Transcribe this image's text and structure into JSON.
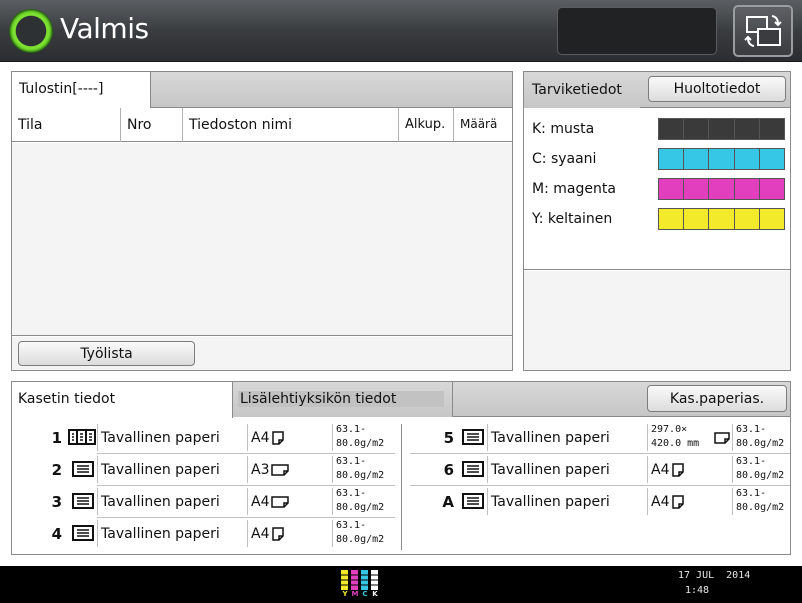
{
  "header": {
    "status": "Valmis"
  },
  "printer_panel": {
    "tab_label": "Tulostin[----]",
    "columns": [
      "Tila",
      "Nro",
      "Tiedoston nimi",
      "Alkup.",
      "Määrä"
    ],
    "job_list_button": "Työlista"
  },
  "supplies_panel": {
    "tab_label": "Tarviketiedot",
    "maintenance_button": "Huoltotiedot",
    "toners": [
      {
        "label": "K: musta",
        "color": "#3a3a3a",
        "level": 1.0
      },
      {
        "label": "C: syaani",
        "color": "#36c6e6",
        "level": 1.0
      },
      {
        "label": "M: magenta",
        "color": "#e23fbf",
        "level": 1.0
      },
      {
        "label": "Y: keltainen",
        "color": "#f2ea2a",
        "level": 1.0
      }
    ]
  },
  "tray_panel": {
    "tab_cassette": "Kasetin tiedot",
    "tab_feeder": "Lisälehtiyksikön tiedot",
    "paper_settings_button": "Kas.paperias.",
    "trays_left": [
      {
        "num": "1",
        "type": "Tavallinen paperi",
        "size": "A4",
        "w1": "63.1-",
        "w2": "80.0g/m2"
      },
      {
        "num": "2",
        "type": "Tavallinen paperi",
        "size": "A3",
        "w1": "63.1-",
        "w2": "80.0g/m2"
      },
      {
        "num": "3",
        "type": "Tavallinen paperi",
        "size": "A4",
        "w1": "63.1-",
        "w2": "80.0g/m2"
      },
      {
        "num": "4",
        "type": "Tavallinen paperi",
        "size": "A4",
        "w1": "63.1-",
        "w2": "80.0g/m2"
      }
    ],
    "trays_right": [
      {
        "num": "5",
        "type": "Tavallinen paperi",
        "size1": "297.0×",
        "size2": "420.0 mm",
        "w1": "63.1-",
        "w2": "80.0g/m2"
      },
      {
        "num": "6",
        "type": "Tavallinen paperi",
        "size": "A4",
        "w1": "63.1-",
        "w2": "80.0g/m2"
      },
      {
        "num": "A",
        "type": "Tavallinen paperi",
        "size": "A4",
        "w1": "63.1-",
        "w2": "80.0g/m2"
      }
    ]
  },
  "footer": {
    "ink_letters": [
      "Y",
      "M",
      "C",
      "K"
    ],
    "date": "17 JUL  2014",
    "time": "1:48"
  }
}
